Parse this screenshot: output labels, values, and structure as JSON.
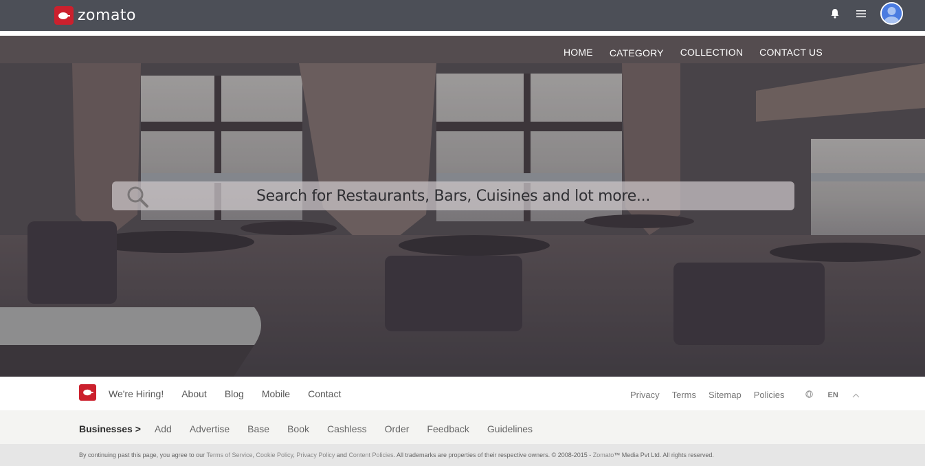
{
  "header": {
    "brand": "zomato",
    "icons": [
      "bell-icon",
      "hamburger-menu-icon",
      "user-avatar-icon"
    ]
  },
  "hero": {
    "nav": [
      "HOME",
      "CATEGORY",
      "COLLECTION",
      "CONTACT US"
    ],
    "search": {
      "placeholder": "Search for Restaurants, Bars, Cuisines and lot more..."
    }
  },
  "footer": {
    "links": [
      "We're Hiring!",
      "About",
      "Blog",
      "Mobile",
      "Contact"
    ],
    "right_links": [
      "Privacy",
      "Terms",
      "Sitemap",
      "Policies"
    ],
    "language": "EN",
    "businesses": {
      "heading": "Businesses >",
      "items": [
        "Add",
        "Advertise",
        "Base",
        "Book",
        "Cashless",
        "Order",
        "Feedback",
        "Guidelines"
      ]
    },
    "legal": {
      "prefix": "By continuing past this page, you agree to our ",
      "terms": "Terms of Service",
      "comma1": ", ",
      "cookie": "Cookie Policy",
      "comma2": ", ",
      "privacy": "Privacy Policy",
      "and": " and ",
      "content": "Content Policies",
      "suffix": ". All trademarks are properties of their respective owners. © 2008-2015 - ",
      "zomato": "Zomato",
      "end": "™ Media Pvt Ltd. All rights reserved."
    }
  },
  "colors": {
    "brand_red": "#cb202d",
    "header_bg": "#4c4f57",
    "footer_bg": "#f4f4f2"
  }
}
